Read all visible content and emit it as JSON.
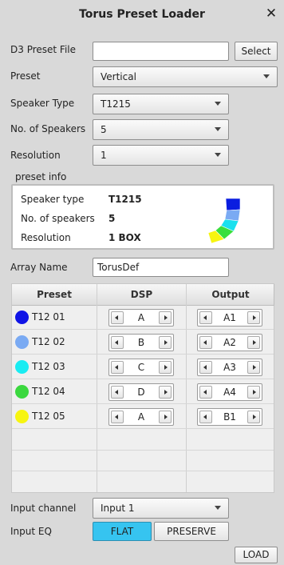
{
  "window": {
    "title": "Torus Preset Loader",
    "close_glyph": "✕"
  },
  "form": {
    "d3_preset_file": {
      "label": "D3 Preset File",
      "value": "",
      "select_label": "Select"
    },
    "preset": {
      "label": "Preset",
      "value": "Vertical"
    },
    "speaker_type": {
      "label": "Speaker Type",
      "value": "T1215"
    },
    "num_speakers": {
      "label": "No. of Speakers",
      "value": "5"
    },
    "resolution": {
      "label": "Resolution",
      "value": "1"
    },
    "array_name": {
      "label": "Array Name",
      "value": "TorusDef"
    }
  },
  "preset_info": {
    "heading": "preset info",
    "rows": [
      {
        "label": "Speaker type",
        "value": "T1215"
      },
      {
        "label": "No. of speakers",
        "value": "5"
      },
      {
        "label": "Resolution",
        "value": "1 BOX"
      }
    ],
    "arc_colors": [
      "#0a1de0",
      "#7aaaf3",
      "#19e0ee",
      "#38df3c",
      "#f7f510"
    ]
  },
  "table": {
    "headers": [
      "Preset",
      "DSP",
      "Output"
    ],
    "rows": [
      {
        "name": "T12 01",
        "color": "#0f13e6",
        "dsp": "A",
        "output": "A1"
      },
      {
        "name": "T12 02",
        "color": "#7aaaf3",
        "dsp": "B",
        "output": "A2"
      },
      {
        "name": "T12 03",
        "color": "#19ecf2",
        "dsp": "C",
        "output": "A3"
      },
      {
        "name": "T12 04",
        "color": "#3bd83f",
        "dsp": "D",
        "output": "A4"
      },
      {
        "name": "T12 05",
        "color": "#f7f510",
        "dsp": "A",
        "output": "B1"
      }
    ]
  },
  "input": {
    "channel": {
      "label": "Input channel",
      "value": "Input 1"
    },
    "eq": {
      "label": "Input EQ",
      "flat_label": "FLAT",
      "preserve_label": "PRESERVE",
      "selected": "FLAT"
    }
  },
  "load_label": "LOAD",
  "colors": {
    "accent_selected": "#36c4f0",
    "panel_bg": "#d9d9d9"
  }
}
